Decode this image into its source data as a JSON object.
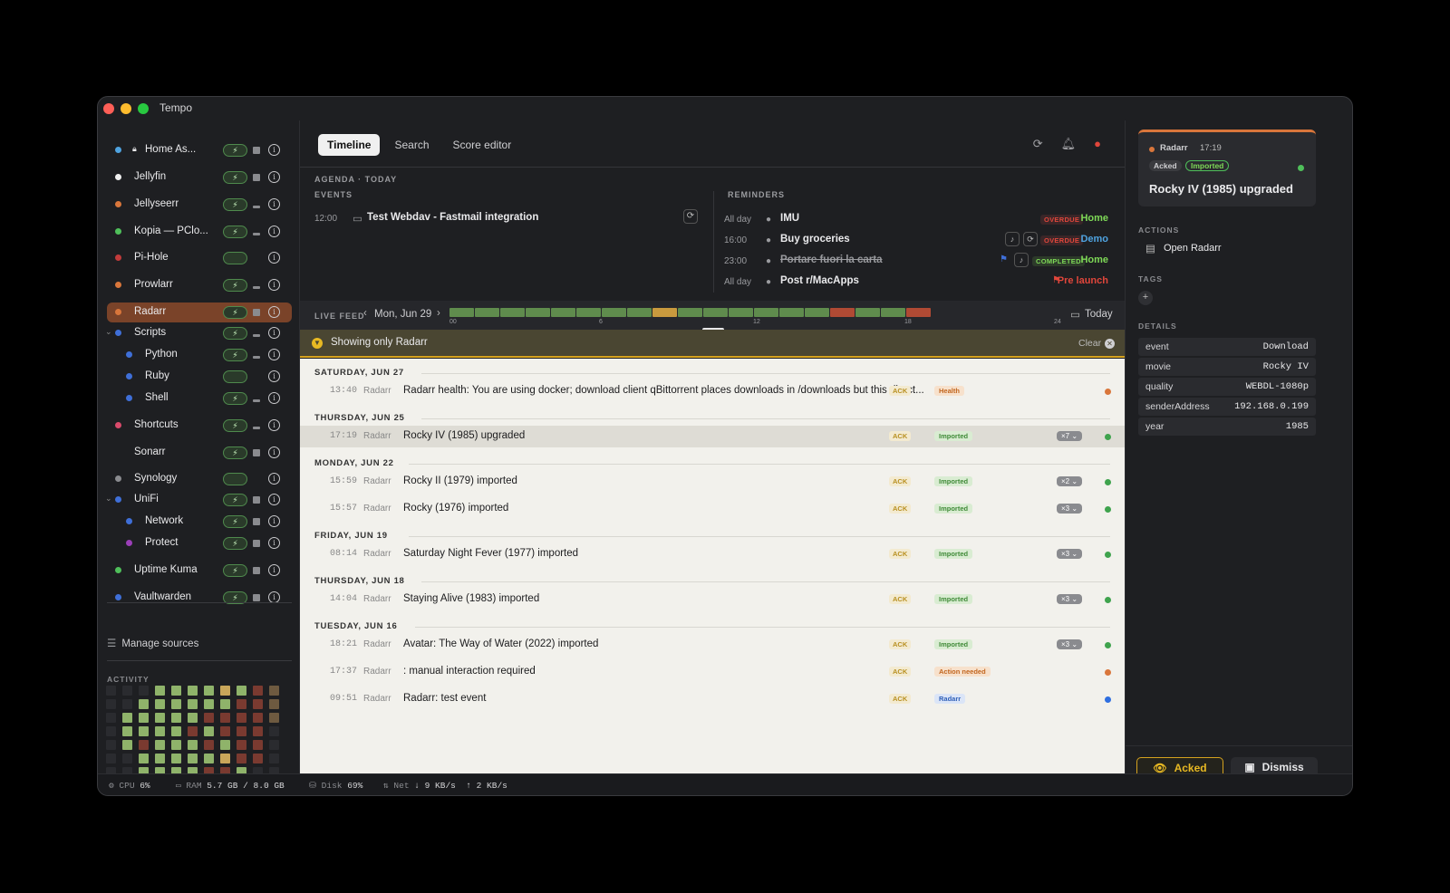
{
  "app": {
    "title": "Tempo"
  },
  "sidebar": {
    "items": [
      {
        "name": "Home As...",
        "color": "#4fa3e0",
        "lock": true,
        "pill": true,
        "sq": "full"
      },
      {
        "name": "Jellyfin",
        "color": "#f0f0f0",
        "pill": true,
        "sq": "full"
      },
      {
        "name": "Jellyseerr",
        "color": "#d9763b",
        "pill": true,
        "sq": "half"
      },
      {
        "name": "Kopia — PClo...",
        "color": "#4fbf5a",
        "pill": true,
        "sq": "half"
      },
      {
        "name": "Pi-Hole",
        "color": "#c23b3b",
        "pill": false,
        "sq": "none"
      },
      {
        "name": "Prowlarr",
        "color": "#d9763b",
        "pill": true,
        "sq": "half"
      },
      {
        "name": "Radarr",
        "color": "#d9763b",
        "pill": true,
        "sq": "full",
        "selected": true
      },
      {
        "name": "Scripts",
        "color": "#3f6fd8",
        "pill": true,
        "sq": "half",
        "expand": true
      },
      {
        "name": "Python",
        "color": "#3f6fd8",
        "pill": true,
        "sq": "half",
        "child": true
      },
      {
        "name": "Ruby",
        "color": "#3f6fd8",
        "pill": false,
        "sq": "none",
        "child": true
      },
      {
        "name": "Shell",
        "color": "#3f6fd8",
        "pill": true,
        "sq": "half",
        "child": true
      },
      {
        "name": "Shortcuts",
        "color": "#d94a6b",
        "pill": true,
        "sq": "half"
      },
      {
        "name": "Sonarr",
        "color": "",
        "pill": true,
        "sq": "full"
      },
      {
        "name": "Synology",
        "color": "#8a8b8f",
        "pill": false,
        "sq": "none"
      },
      {
        "name": "UniFi",
        "color": "#3f6fd8",
        "pill": true,
        "sq": "full",
        "expand": true
      },
      {
        "name": "Network",
        "color": "#3f6fd8",
        "pill": true,
        "sq": "full",
        "child": true
      },
      {
        "name": "Protect",
        "color": "#9b3fb8",
        "pill": true,
        "sq": "full",
        "child": true
      },
      {
        "name": "Uptime Kuma",
        "color": "#4fbf5a",
        "pill": true,
        "sq": "full"
      },
      {
        "name": "Vaultwarden",
        "color": "#3f6fd8",
        "pill": true,
        "sq": "full"
      }
    ],
    "manage": "Manage sources",
    "activity_label": "ACTIVITY"
  },
  "tabs": [
    "Timeline",
    "Search",
    "Score editor"
  ],
  "agenda": {
    "title": "AGENDA · TODAY",
    "events_label": "EVENTS",
    "reminders_label": "REMINDERS",
    "event": {
      "time": "12:00",
      "title": "Test Webdav - Fastmail integration"
    },
    "reminders": [
      {
        "time": "All day",
        "title": "IMU",
        "badge": "OVERDUE",
        "list": "Home",
        "list_color": "#7ed957"
      },
      {
        "time": "16:00",
        "title": "Buy groceries",
        "badge": "OVERDUE",
        "list": "Demo",
        "list_color": "#4fa3e0"
      },
      {
        "time": "23:00",
        "title": "Portare fuori la carta",
        "badge": "COMPLETED",
        "list": "Home",
        "list_color": "#7ed957"
      },
      {
        "time": "All day",
        "title": "Post r/MacApps",
        "badge": "",
        "list": "Pre launch",
        "list_color": "#e0463b"
      }
    ]
  },
  "feed": {
    "label": "LIVE FEED",
    "date": "Mon, Jun 29",
    "today": "Today",
    "ticks": [
      "00",
      "6",
      "12",
      "18",
      "24"
    ],
    "hour_colors": [
      "#5f8c4d",
      "#5f8c4d",
      "#5f8c4d",
      "#5f8c4d",
      "#5f8c4d",
      "#5f8c4d",
      "#5f8c4d",
      "#5f8c4d",
      "#c99a3e",
      "#5f8c4d",
      "#5f8c4d",
      "#5f8c4d",
      "#5f8c4d",
      "#5f8c4d",
      "#5f8c4d",
      "#b04a34",
      "#5f8c4d",
      "#5f8c4d",
      "#b04a34"
    ]
  },
  "filter": {
    "text": "Showing only Radarr",
    "clear": "Clear"
  },
  "events": [
    {
      "day": "SATURDAY, JUN 27",
      "rows": [
        {
          "time": "13:40",
          "src": "Radarr",
          "title": "Radarr health: You are using docker; download client qBittorrent places downloads in /downloads but this direct...",
          "tag": "Health",
          "tag_bg": "#f7e1cc",
          "tag_fg": "#c2661f",
          "count": "",
          "dot": "#d9763b"
        }
      ]
    },
    {
      "day": "THURSDAY, JUN 25",
      "rows": [
        {
          "time": "17:19",
          "src": "Radarr",
          "title": "Rocky IV (1985) upgraded",
          "tag": "Imported",
          "tag_bg": "#d9ecd2",
          "tag_fg": "#3f8a37",
          "count": "×7",
          "dot": "#3fa34d",
          "selected": true
        }
      ]
    },
    {
      "day": "MONDAY, JUN 22",
      "rows": [
        {
          "time": "15:59",
          "src": "Radarr",
          "title": "Rocky II (1979) imported",
          "tag": "Imported",
          "tag_bg": "#d9ecd2",
          "tag_fg": "#3f8a37",
          "count": "×2",
          "dot": "#3fa34d"
        },
        {
          "time": "15:57",
          "src": "Radarr",
          "title": "Rocky (1976) imported",
          "tag": "Imported",
          "tag_bg": "#d9ecd2",
          "tag_fg": "#3f8a37",
          "count": "×3",
          "dot": "#3fa34d"
        }
      ]
    },
    {
      "day": "FRIDAY, JUN 19",
      "rows": [
        {
          "time": "08:14",
          "src": "Radarr",
          "title": "Saturday Night Fever (1977) imported",
          "tag": "Imported",
          "tag_bg": "#d9ecd2",
          "tag_fg": "#3f8a37",
          "count": "×3",
          "dot": "#3fa34d"
        }
      ]
    },
    {
      "day": "THURSDAY, JUN 18",
      "rows": [
        {
          "time": "14:04",
          "src": "Radarr",
          "title": "Staying Alive (1983) imported",
          "tag": "Imported",
          "tag_bg": "#d9ecd2",
          "tag_fg": "#3f8a37",
          "count": "×3",
          "dot": "#3fa34d"
        }
      ]
    },
    {
      "day": "TUESDAY, JUN 16",
      "rows": [
        {
          "time": "18:21",
          "src": "Radarr",
          "title": "Avatar: The Way of Water (2022) imported",
          "tag": "Imported",
          "tag_bg": "#d9ecd2",
          "tag_fg": "#3f8a37",
          "count": "×3",
          "dot": "#3fa34d"
        },
        {
          "time": "17:37",
          "src": "Radarr",
          "title": ": manual interaction required",
          "tag": "Action needed",
          "tag_bg": "#f7e1cc",
          "tag_fg": "#c2661f",
          "count": "",
          "dot": "#d9763b"
        },
        {
          "time": "09:51",
          "src": "Radarr",
          "title": "Radarr: test event",
          "tag": "Radarr",
          "tag_bg": "#dbe5f7",
          "tag_fg": "#2f5fb8",
          "count": "",
          "dot": "#2f6fe0"
        }
      ]
    }
  ],
  "ack_label": "ACK",
  "detail": {
    "source": "Radarr",
    "time": "17:19",
    "badge_acked": "Acked",
    "badge_imported": "Imported",
    "title": "Rocky IV (1985) upgraded",
    "actions_label": "ACTIONS",
    "open": "Open Radarr",
    "tags_label": "TAGS",
    "details_label": "DETAILS",
    "details": [
      {
        "k": "event",
        "v": "Download"
      },
      {
        "k": "movie",
        "v": "Rocky IV"
      },
      {
        "k": "quality",
        "v": "WEBDL-1080p"
      },
      {
        "k": "senderAddress",
        "v": "192.168.0.199"
      },
      {
        "k": "year",
        "v": "1985"
      }
    ],
    "acked_btn": "Acked",
    "dismiss_btn": "Dismiss"
  },
  "status": {
    "cpu_label": "CPU",
    "cpu": "6%",
    "ram_label": "RAM",
    "ram": "5.7 GB / 8.0 GB",
    "disk_label": "Disk",
    "disk": "69%",
    "net_label": "Net",
    "down": "↓ 9 KB/s",
    "up": "↑ 2 KB/s"
  }
}
